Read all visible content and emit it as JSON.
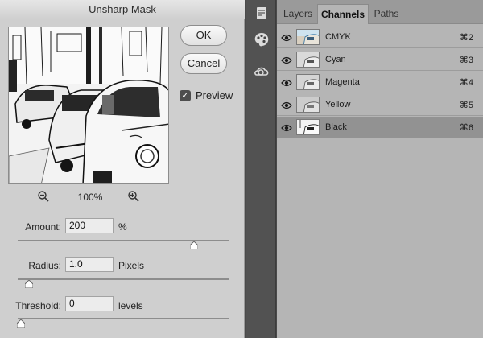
{
  "dialog": {
    "title": "Unsharp Mask",
    "ok_label": "OK",
    "cancel_label": "Cancel",
    "preview_label": "Preview",
    "preview_checked": true,
    "zoom_level": "100%",
    "amount": {
      "label": "Amount:",
      "value": "200",
      "unit": "%",
      "slider_fraction": 0.82
    },
    "radius": {
      "label": "Radius:",
      "value": "1.0",
      "unit": "Pixels",
      "slider_fraction": 0.04
    },
    "threshold": {
      "label": "Threshold:",
      "value": "0",
      "unit": "levels",
      "slider_fraction": 0.0
    }
  },
  "toolbar": {
    "icons": [
      "properties-icon",
      "color-palette-icon",
      "libraries-icon"
    ]
  },
  "panel": {
    "tabs": [
      {
        "label": "Layers",
        "active": false
      },
      {
        "label": "Channels",
        "active": true
      },
      {
        "label": "Paths",
        "active": false
      }
    ],
    "channels": [
      {
        "name": "CMYK",
        "shortcut": "⌘2",
        "selected": false
      },
      {
        "name": "Cyan",
        "shortcut": "⌘3",
        "selected": false
      },
      {
        "name": "Magenta",
        "shortcut": "⌘4",
        "selected": false
      },
      {
        "name": "Yellow",
        "shortcut": "⌘5",
        "selected": false
      },
      {
        "name": "Black",
        "shortcut": "⌘6",
        "selected": true
      }
    ]
  }
}
